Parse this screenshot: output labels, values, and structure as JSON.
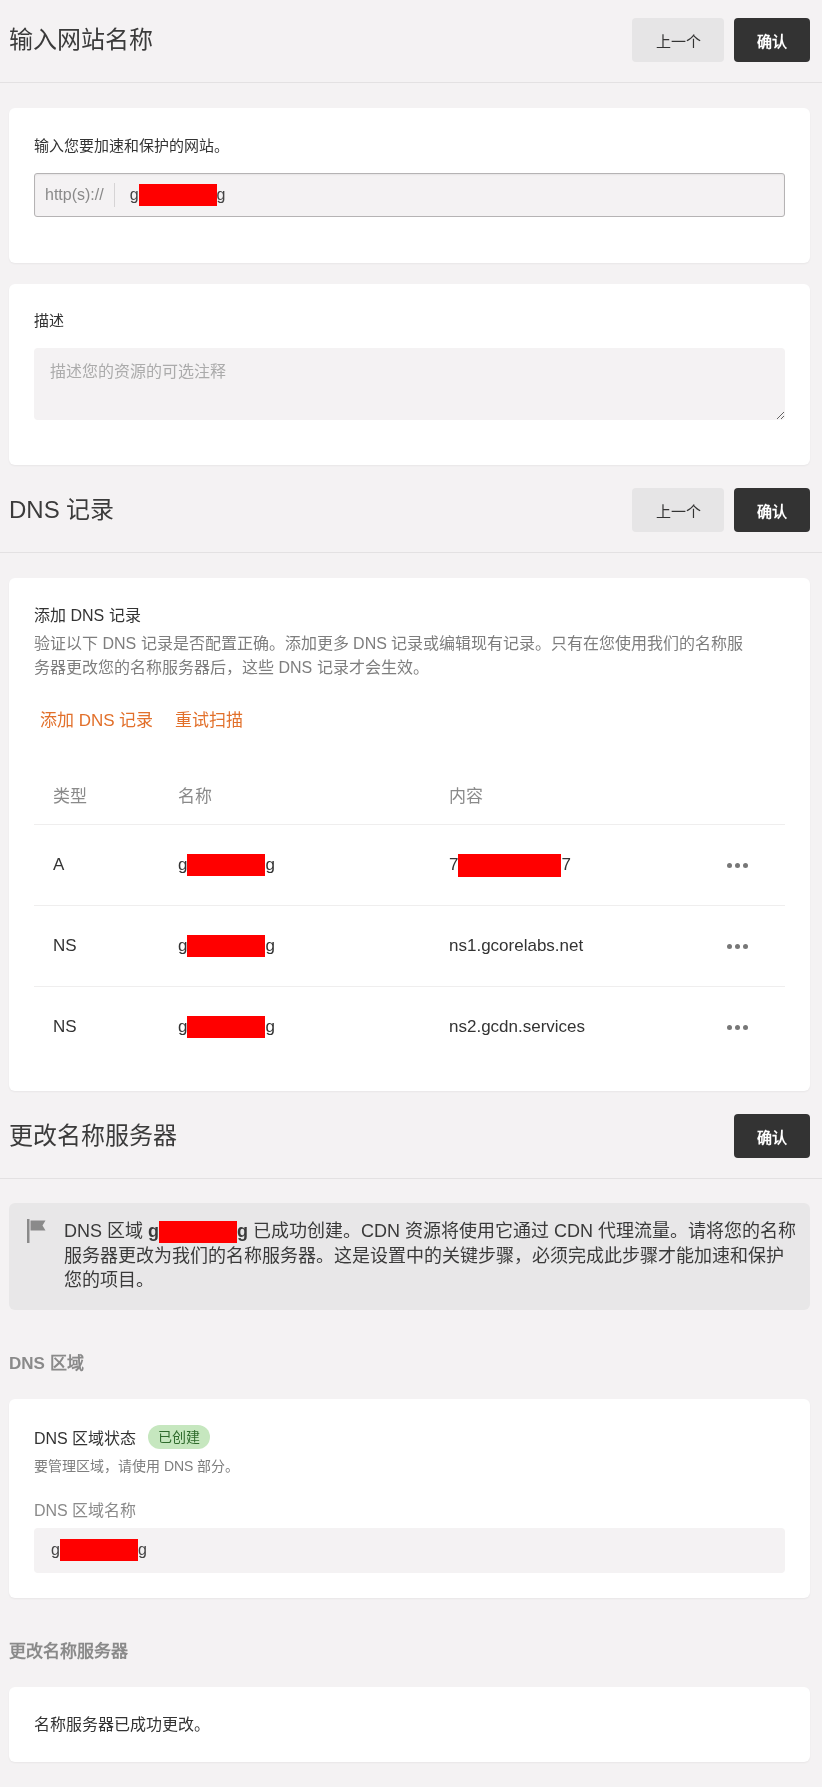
{
  "website_step": {
    "title": "输入网站名称",
    "buttons": [
      {
        "label": "上一个",
        "kind": "back"
      },
      {
        "label": "确认",
        "kind": "confirm"
      }
    ],
    "site_card": {
      "label": "输入您要加速和保护的网站。",
      "prefix": "http(s)://",
      "value": {
        "start": "g",
        "redacted": true,
        "end": "g"
      }
    },
    "description_card": {
      "label": "描述",
      "placeholder": "描述您的资源的可选注释"
    }
  },
  "dns_step": {
    "title": "DNS 记录",
    "buttons": [
      {
        "label": "上一个",
        "kind": "back"
      },
      {
        "label": "确认",
        "kind": "confirm"
      }
    ],
    "card": {
      "title": "添加 DNS 记录",
      "description": "验证以下 DNS 记录是否配置正确。添加更多 DNS 记录或编辑现有记录。只有在您使用我们的名称服务器更改您的名称服务器后，这些 DNS 记录才会生效。",
      "links": [
        "添加 DNS 记录",
        "重试扫描"
      ],
      "table": {
        "columns": [
          "类型",
          "名称",
          "内容"
        ],
        "rows": [
          {
            "type": "A",
            "name": {
              "start": "g",
              "redacted": true,
              "end": "g"
            },
            "content": {
              "start": "7",
              "redacted": true,
              "end": "7"
            }
          },
          {
            "type": "NS",
            "name": {
              "start": "g",
              "redacted": true,
              "end": "g"
            },
            "content": "ns1.gcorelabs.net"
          },
          {
            "type": "NS",
            "name": {
              "start": "g",
              "redacted": true,
              "end": "g"
            },
            "content": "ns2.gcdn.services"
          }
        ]
      }
    }
  },
  "nameserver_step": {
    "title": "更改名称服务器",
    "buttons": [
      {
        "label": "确认",
        "kind": "confirm"
      }
    ],
    "alert": {
      "text_start": "DNS 区域 ",
      "domain": {
        "start": "g",
        "redacted": true,
        "end": "g"
      },
      "text_end": " 已成功创建。CDN 资源将使用它通过 CDN 代理流量。请将您的名称服务器更改为我们的名称服务器。这是设置中的关键步骤，必须完成此步骤才能加速和保护您的项目。"
    },
    "zone": {
      "heading": "DNS 区域",
      "status_label": "DNS 区域状态",
      "status": "已创建",
      "hint": "要管理区域，请使用 DNS 部分。",
      "name_label": "DNS 区域名称",
      "name_value": {
        "start": "g",
        "redacted": true,
        "end": "g"
      }
    },
    "nameservers": {
      "heading": "更改名称服务器",
      "message": "名称服务器已成功更改。"
    }
  }
}
